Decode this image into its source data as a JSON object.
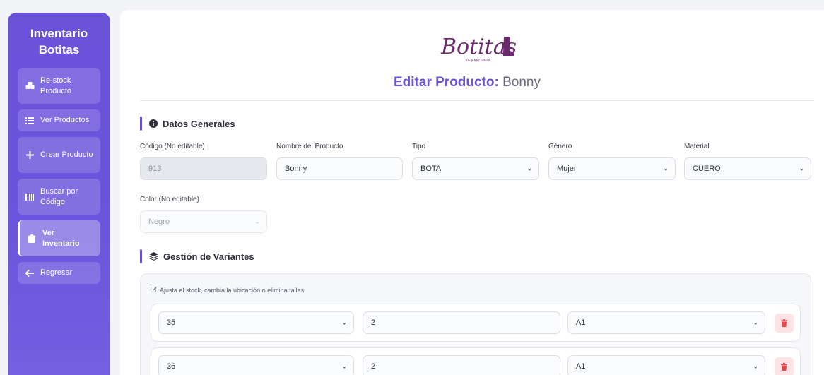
{
  "sidebar": {
    "brand": "Inventario Botitas",
    "items": [
      {
        "icon": "boxes-icon",
        "label": "Re-stock Producto"
      },
      {
        "icon": "list-icon",
        "label": "Ver Productos"
      },
      {
        "icon": "plus-icon",
        "label": "Crear Producto"
      },
      {
        "icon": "barcode-icon",
        "label": "Buscar por Código"
      },
      {
        "icon": "clipboard-icon",
        "label": "Ver Inventario",
        "active": true
      },
      {
        "icon": "arrow-left-icon",
        "label": "Regresar"
      }
    ]
  },
  "logo": {
    "text": "Botitas",
    "tagline": "DE JENNY JUNIOR",
    "color": "#6b2a6e"
  },
  "page": {
    "title_prefix": "Editar Producto:",
    "product_name": "Bonny"
  },
  "general": {
    "heading": "Datos Generales",
    "fields": {
      "codigo": {
        "label": "Código (No editable)",
        "value": "913"
      },
      "nombre": {
        "label": "Nombre del Producto",
        "value": "Bonny"
      },
      "tipo": {
        "label": "Tipo",
        "value": "BOTA"
      },
      "genero": {
        "label": "Género",
        "value": "Mujer"
      },
      "material": {
        "label": "Material",
        "value": "CUERO"
      },
      "color": {
        "label": "Color (No editable)",
        "value": "Negro"
      }
    }
  },
  "variants": {
    "heading": "Gestión de Variantes",
    "hint": "Ajusta el stock, cambia la ubicación o elimina tallas.",
    "rows": [
      {
        "talla": "35",
        "stock": "2",
        "ubicacion": "A1"
      },
      {
        "talla": "36",
        "stock": "2",
        "ubicacion": "A1"
      }
    ]
  },
  "colors": {
    "accent": "#6a52d9",
    "danger": "#e0464f"
  }
}
